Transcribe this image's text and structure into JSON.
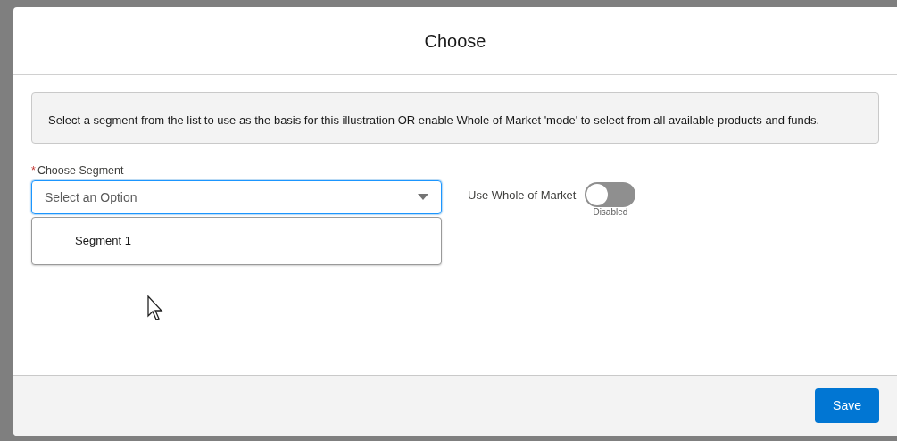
{
  "modal": {
    "title": "Choose",
    "info": "Select a segment from the list to use as the basis for this illustration OR enable Whole of Market 'mode' to select from all available products and funds.",
    "segment_field": {
      "required_mark": "*",
      "label": "Choose Segment",
      "placeholder": "Select an Option",
      "expanded": true,
      "options": [
        {
          "label": "Segment 1",
          "selected": false
        }
      ]
    },
    "whole_of_market": {
      "label": "Use Whole of Market",
      "on": false,
      "state_text": "Disabled"
    },
    "buttons": [
      "Save"
    ]
  }
}
